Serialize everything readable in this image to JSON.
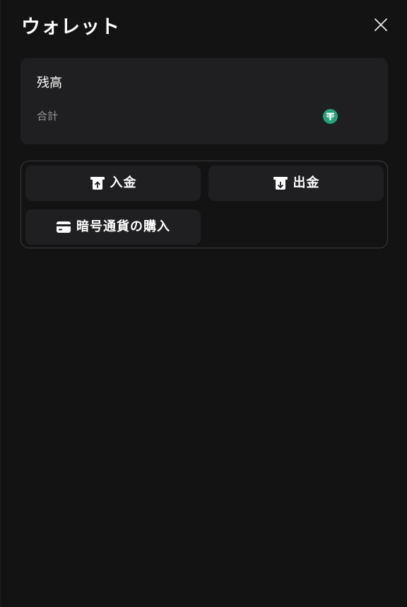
{
  "header": {
    "title": "ウォレット",
    "close_icon": "close-icon"
  },
  "balance": {
    "title": "残高",
    "total_label": "合計",
    "coin_icon": "tether-icon",
    "coin_color": "#26a17b"
  },
  "actions": {
    "deposit_label": "入金",
    "withdraw_label": "出金",
    "buy_crypto_label": "暗号通貨の購入"
  },
  "colors": {
    "background": "#131314",
    "card": "#1f1f21",
    "border": "#3a3a3d",
    "muted_text": "#9a9a9e"
  }
}
